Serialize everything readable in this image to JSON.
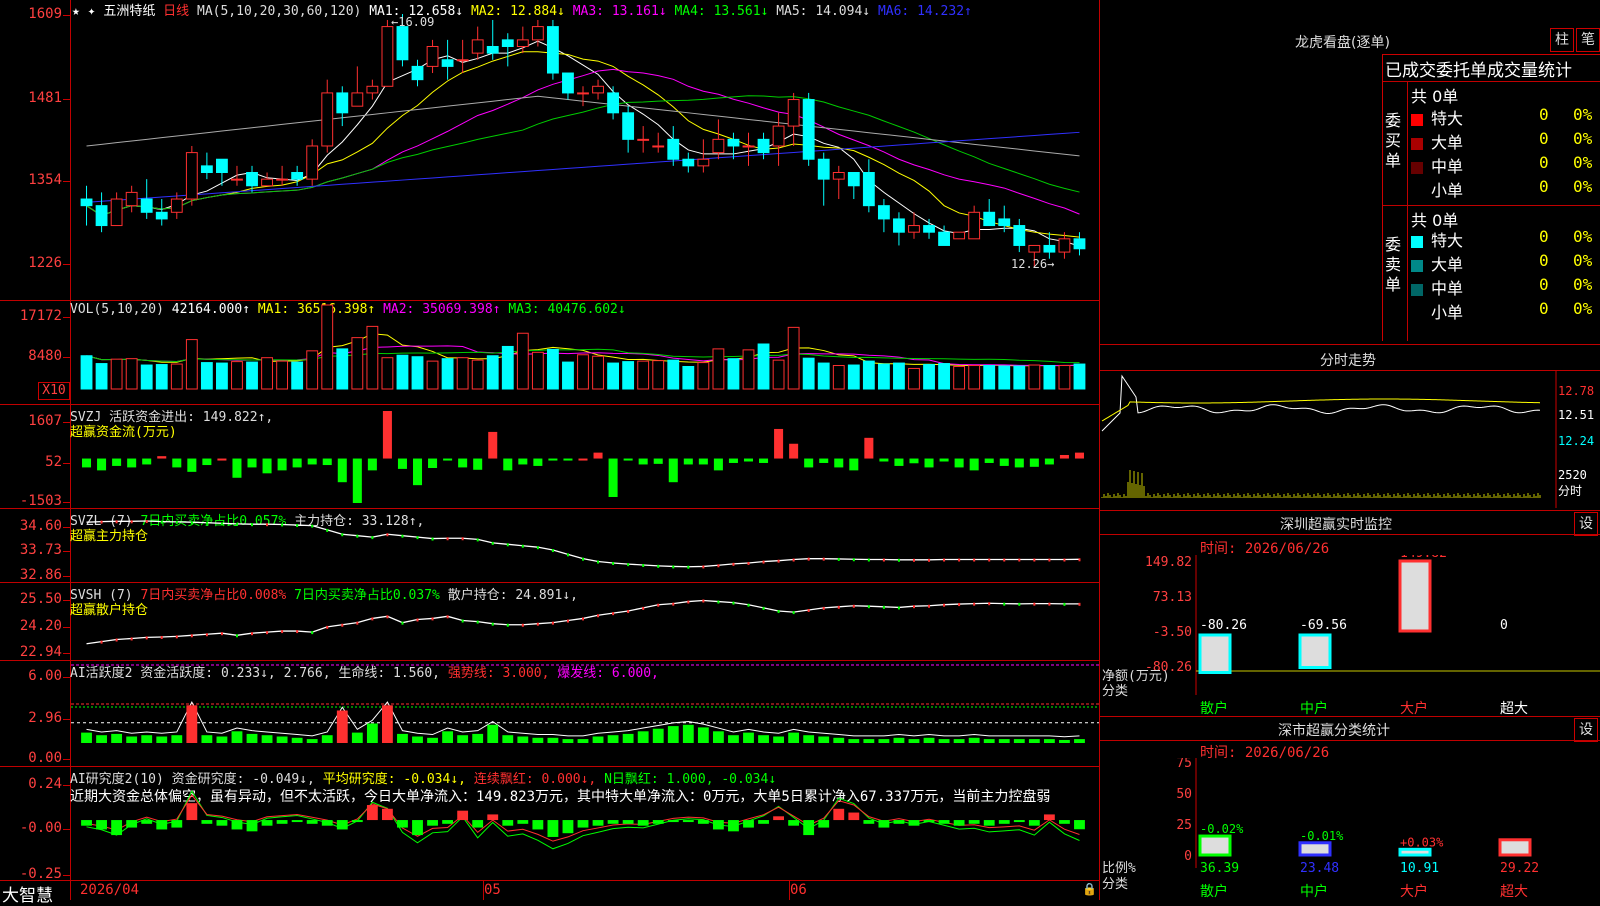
{
  "stock": {
    "name": "五洲特纸",
    "period": "日线",
    "ma_header": [
      {
        "t": "MA(5,10,20,30,60,120)",
        "c": "#ddd"
      },
      {
        "t": "MA1: 12.658↓",
        "c": "#ffffff"
      },
      {
        "t": "MA2: 12.884↓",
        "c": "#ffff00"
      },
      {
        "t": "MA3: 13.161↓",
        "c": "#ff00ff"
      },
      {
        "t": "MA4: 13.561↓",
        "c": "#00ff00"
      },
      {
        "t": "MA5: 14.094↓",
        "c": "#ddd"
      },
      {
        "t": "MA6: 14.232↑",
        "c": "#3030ff"
      }
    ],
    "y_labels": [
      "1609",
      "1481",
      "1354",
      "1226"
    ],
    "high_marker": "16.09",
    "low_marker": "12.26"
  },
  "vol": {
    "header": [
      {
        "t": "VOL(5,10,20)",
        "c": "#ddd"
      },
      {
        "t": "42164.000↑",
        "c": "#fff"
      },
      {
        "t": "MA1: 36516.398↑",
        "c": "#ffff00"
      },
      {
        "t": "MA2: 35069.398↑",
        "c": "#ff00ff"
      },
      {
        "t": "MA3: 40476.602↓",
        "c": "#00ff00"
      }
    ],
    "y_labels": [
      "17172",
      "8480"
    ],
    "unit_box": "X10"
  },
  "svzj": {
    "header": [
      {
        "t": "SVZJ  活跃资金进出: 149.822↑,",
        "c": "#ddd"
      }
    ],
    "subtitle": "超赢资金流(万元)",
    "y_labels": [
      "1607",
      "52",
      "-1503"
    ]
  },
  "svzl": {
    "header": [
      {
        "t": "SVZL (7)",
        "c": "#ddd"
      },
      {
        "t": "7日内买卖净占比0.057%",
        "c": "#00ff00"
      },
      {
        "t": "主力持仓: 33.128↑,",
        "c": "#ddd"
      }
    ],
    "subtitle": "超赢主力持仓",
    "y_labels": [
      "34.60",
      "33.73",
      "32.86"
    ]
  },
  "svsh": {
    "header": [
      {
        "t": "SVSH (7)",
        "c": "#ddd"
      },
      {
        "t": "7日内买卖净占比0.008%",
        "c": "#ff3030"
      },
      {
        "t": "7日内买卖净占比0.037%",
        "c": "#00ff00"
      },
      {
        "t": "散户持仓: 24.891↓,",
        "c": "#ddd"
      }
    ],
    "subtitle": "超赢散户持仓",
    "y_labels": [
      "25.50",
      "24.20",
      "22.94"
    ]
  },
  "ai1": {
    "header": [
      {
        "t": "AI活跃度2 资金活跃度: 0.233↓, 2.766, 生命线: 1.560,",
        "c": "#ddd"
      },
      {
        "t": "强势线: 3.000,",
        "c": "#ff3030"
      },
      {
        "t": "爆发线: 6.000,",
        "c": "#ff00ff"
      }
    ],
    "y_labels": [
      "6.00",
      "2.96",
      "0.00"
    ]
  },
  "ai2": {
    "header": [
      {
        "t": "AI研究度2(10) 资金研究度: -0.049↓,",
        "c": "#ddd"
      },
      {
        "t": "平均研究度: -0.034↓,",
        "c": "#ffff00"
      },
      {
        "t": "连续飘红: 0.000↓,",
        "c": "#ff3030"
      },
      {
        "t": "N日飘红: 1.000, -0.034↓",
        "c": "#00ff00"
      }
    ],
    "comment": "近期大资金总体偏空，虽有异动，但不太活跃，今日大单净流入：149.823万元，其中特大单净流入：0万元，大单5日累计净入67.337万元，当前主力控盘弱",
    "y_labels": [
      "0.24",
      "-0.00",
      "-0.25"
    ]
  },
  "footer": {
    "brand": "大智慧",
    "dates": [
      "2026/04",
      "05",
      "06"
    ]
  },
  "right": {
    "dragon_title": "龙虎看盘(逐单)",
    "btn_zhu": "柱",
    "btn_bi": "笔",
    "table_title": "已成交委托单成交量统计",
    "buy_side_label": "委买单",
    "sell_side_label": "委卖单",
    "buy_total": "共 0单",
    "sell_total": "共 0单",
    "buy_rows": [
      {
        "label": "特大",
        "val": "0",
        "pct": "0%",
        "color": "#ff0000"
      },
      {
        "label": "大单",
        "val": "0",
        "pct": "0%",
        "color": "#aa0000"
      },
      {
        "label": "中单",
        "val": "0",
        "pct": "0%",
        "color": "#660000"
      },
      {
        "label": "小单",
        "val": "0",
        "pct": "0%",
        "color": "#000000"
      }
    ],
    "sell_rows": [
      {
        "label": "特大",
        "val": "0",
        "pct": "0%",
        "color": "#00ffff"
      },
      {
        "label": "大单",
        "val": "0",
        "pct": "0%",
        "color": "#008888"
      },
      {
        "label": "中单",
        "val": "0",
        "pct": "0%",
        "color": "#006666"
      },
      {
        "label": "小单",
        "val": "0",
        "pct": "0%",
        "color": "#000000"
      }
    ],
    "intraday_title": "分时走势",
    "intraday_labels": [
      "12.78",
      "12.51",
      "12.24",
      "2520",
      "分时"
    ],
    "monitor_title": "深圳超赢实时监控",
    "btn_set1": "设",
    "monitor_time": "时间: 2026/06/26",
    "monitor_y": [
      "149.82",
      "73.13",
      "-3.50",
      "-80.26"
    ],
    "monitor_axis": [
      "净额(万元)",
      "分类"
    ],
    "monitor_cats": [
      "散户",
      "中户",
      "大户",
      "超大"
    ],
    "monitor_vals": [
      "-80.26",
      "-69.56",
      "149.82",
      "0"
    ],
    "class_title": "深市超赢分类统计",
    "btn_set2": "设",
    "class_time": "时间: 2026/06/26",
    "class_y": [
      "75",
      "50",
      "25",
      "0"
    ],
    "class_axis": [
      "比例%",
      "分类"
    ],
    "class_cats": [
      "散户",
      "中户",
      "大户",
      "超大"
    ],
    "class_vals": [
      "36.39",
      "23.48",
      "10.91",
      "29.22"
    ],
    "class_chg": [
      "-0.02%",
      "-0.01%",
      "+0.03%",
      ""
    ]
  },
  "chart_data": [
    {
      "type": "candlestick",
      "title": "五洲特纸 日线",
      "x_labels": [
        "2026/04",
        "05",
        "06"
      ],
      "ylim": [
        12.26,
        16.09
      ],
      "ohlc": [
        [
          13.3,
          13.2,
          13.5,
          12.9
        ],
        [
          13.2,
          12.9,
          13.4,
          12.8
        ],
        [
          12.9,
          13.3,
          13.4,
          12.9
        ],
        [
          13.2,
          13.4,
          13.5,
          13.1
        ],
        [
          13.3,
          13.1,
          13.6,
          13.0
        ],
        [
          13.1,
          13.0,
          13.3,
          12.9
        ],
        [
          13.1,
          13.3,
          13.4,
          13.0
        ],
        [
          13.3,
          14.0,
          14.1,
          13.2
        ],
        [
          13.8,
          13.7,
          14.0,
          13.6
        ],
        [
          13.9,
          13.7,
          13.9,
          13.5
        ],
        [
          13.6,
          13.6,
          13.8,
          13.5
        ],
        [
          13.7,
          13.5,
          13.8,
          13.4
        ],
        [
          13.5,
          13.6,
          13.7,
          13.5
        ],
        [
          13.6,
          13.6,
          13.8,
          13.5
        ],
        [
          13.7,
          13.6,
          13.8,
          13.5
        ],
        [
          13.6,
          14.1,
          14.2,
          13.5
        ],
        [
          14.1,
          14.9,
          15.1,
          14.0
        ],
        [
          14.9,
          14.6,
          15.0,
          14.4
        ],
        [
          14.7,
          14.9,
          15.3,
          14.7
        ],
        [
          14.9,
          15.0,
          15.1,
          14.8
        ],
        [
          15.0,
          15.9,
          16.0,
          15.0
        ],
        [
          15.9,
          15.4,
          16.09,
          15.3
        ],
        [
          15.3,
          15.1,
          15.4,
          15.0
        ],
        [
          15.3,
          15.6,
          15.7,
          15.2
        ],
        [
          15.4,
          15.3,
          15.7,
          15.1
        ],
        [
          15.4,
          15.4,
          15.7,
          15.2
        ],
        [
          15.5,
          15.7,
          15.9,
          15.4
        ],
        [
          15.6,
          15.5,
          16.0,
          15.4
        ],
        [
          15.7,
          15.6,
          15.8,
          15.3
        ],
        [
          15.6,
          15.7,
          15.9,
          15.5
        ],
        [
          15.7,
          15.9,
          16.0,
          15.6
        ],
        [
          15.9,
          15.2,
          16.0,
          15.1
        ],
        [
          15.2,
          14.9,
          15.2,
          14.8
        ],
        [
          14.9,
          14.9,
          15.0,
          14.7
        ],
        [
          14.9,
          15.0,
          15.1,
          14.8
        ],
        [
          14.9,
          14.6,
          15.0,
          14.5
        ],
        [
          14.6,
          14.2,
          14.7,
          14.0
        ],
        [
          14.2,
          14.2,
          14.4,
          14.0
        ],
        [
          14.1,
          14.1,
          14.3,
          14.0
        ],
        [
          14.2,
          13.9,
          14.4,
          13.8
        ],
        [
          13.9,
          13.8,
          14.0,
          13.7
        ],
        [
          13.8,
          13.9,
          14.2,
          13.7
        ],
        [
          14.0,
          14.2,
          14.5,
          13.9
        ],
        [
          14.2,
          14.1,
          14.3,
          13.9
        ],
        [
          14.1,
          14.1,
          14.3,
          13.8
        ],
        [
          14.2,
          14.0,
          14.3,
          13.9
        ],
        [
          14.1,
          14.4,
          14.6,
          13.8
        ],
        [
          14.4,
          14.8,
          14.9,
          14.1
        ],
        [
          14.8,
          13.9,
          14.9,
          13.8
        ],
        [
          13.9,
          13.6,
          14.0,
          13.2
        ],
        [
          13.6,
          13.7,
          13.8,
          13.3
        ],
        [
          13.7,
          13.5,
          13.7,
          13.3
        ],
        [
          13.7,
          13.2,
          13.9,
          13.1
        ],
        [
          13.2,
          13.0,
          13.3,
          12.8
        ],
        [
          13.0,
          12.8,
          13.1,
          12.6
        ],
        [
          12.8,
          12.9,
          13.1,
          12.7
        ],
        [
          12.9,
          12.8,
          13.0,
          12.7
        ],
        [
          12.8,
          12.6,
          12.9,
          12.6
        ],
        [
          12.7,
          12.8,
          12.8,
          12.7
        ],
        [
          12.7,
          13.1,
          13.2,
          12.7
        ],
        [
          13.1,
          12.9,
          13.3,
          12.9
        ],
        [
          13.0,
          12.9,
          13.2,
          12.8
        ],
        [
          12.9,
          12.6,
          13.0,
          12.5
        ],
        [
          12.5,
          12.6,
          12.6,
          12.26
        ],
        [
          12.6,
          12.5,
          12.8,
          12.4
        ],
        [
          12.5,
          12.7,
          12.8,
          12.4
        ],
        [
          12.7,
          12.55,
          12.8,
          12.45
        ]
      ]
    },
    {
      "type": "bar",
      "title": "VOL(5,10,20)",
      "ylim": [
        0,
        17172
      ],
      "values": [
        6800,
        5200,
        6100,
        6200,
        4900,
        5000,
        5100,
        10100,
        5400,
        5300,
        5600,
        5500,
        6400,
        5700,
        5500,
        7800,
        17172,
        8200,
        10500,
        12800,
        6400,
        6900,
        6600,
        5700,
        6200,
        6400,
        5900,
        6800,
        8700,
        11400,
        7500,
        8100,
        5500,
        7000,
        6700,
        5300,
        5600,
        5700,
        5800,
        5900,
        4600,
        5400,
        8200,
        6200,
        8000,
        9200,
        5900,
        12600,
        6300,
        5300,
        4800,
        4900,
        5700,
        5100,
        5300,
        4200,
        5000,
        5200,
        4600,
        4800,
        4800,
        4700,
        4700,
        4900,
        4800,
        4800,
        5100
      ],
      "colors_up": "#ff3030",
      "colors_down": "#00ffff"
    },
    {
      "type": "bar",
      "title": "SVZJ 超赢资金流(万元)",
      "ylim": [
        -1503,
        1607
      ],
      "values": [
        -300,
        -400,
        -250,
        -300,
        -200,
        80,
        -300,
        -450,
        -220,
        0,
        -650,
        -300,
        -500,
        -400,
        -300,
        -200,
        -220,
        -800,
        -1503,
        -400,
        1607,
        -350,
        -900,
        -320,
        -50,
        -300,
        -380,
        900,
        -400,
        -200,
        -250,
        -50,
        -40,
        0,
        200,
        -1300,
        -40,
        -200,
        -180,
        -800,
        -200,
        -200,
        -400,
        -150,
        -100,
        -150,
        1000,
        500,
        -300,
        -150,
        -300,
        -400,
        700,
        -100,
        -250,
        -160,
        -300,
        -100,
        -300,
        -400,
        -150,
        -250,
        -300,
        -280,
        -200,
        120,
        200
      ],
      "colors_pos": "#ff3030",
      "colors_neg": "#00ff00"
    },
    {
      "type": "line",
      "title": "SVZL 超赢主力持仓",
      "ylim": [
        32.86,
        34.6
      ],
      "values": [
        34.42,
        34.44,
        34.45,
        34.45,
        34.46,
        34.44,
        34.43,
        34.42,
        34.4,
        34.38,
        34.36,
        34.35,
        34.35,
        34.34,
        34.32,
        34.3,
        34.15,
        34.0,
        33.95,
        33.9,
        34.0,
        33.95,
        33.9,
        33.85,
        33.86,
        33.86,
        33.82,
        33.7,
        33.65,
        33.6,
        33.55,
        33.45,
        33.3,
        33.15,
        33.05,
        33.0,
        32.96,
        32.93,
        32.9,
        32.88,
        32.87,
        32.88,
        32.92,
        32.97,
        33.0,
        33.05,
        33.08,
        33.12,
        33.15,
        33.15,
        33.14,
        33.13,
        33.12,
        33.12,
        33.11,
        33.11,
        33.11,
        33.12,
        33.12,
        33.12,
        33.12,
        33.12,
        33.12,
        33.12,
        33.12,
        33.12,
        33.128
      ]
    },
    {
      "type": "line",
      "title": "SVSH 超赢散户持仓",
      "ylim": [
        22.94,
        25.5
      ],
      "values": [
        23.0,
        23.1,
        23.2,
        23.25,
        23.3,
        23.32,
        23.35,
        23.4,
        23.45,
        23.5,
        23.4,
        23.5,
        23.55,
        23.6,
        23.6,
        23.55,
        23.8,
        23.9,
        24.0,
        24.2,
        24.3,
        24.0,
        24.15,
        24.2,
        24.3,
        24.1,
        24.05,
        23.95,
        23.9,
        23.9,
        23.95,
        24.0,
        24.1,
        24.2,
        24.35,
        24.45,
        24.55,
        24.7,
        24.85,
        24.9,
        25.0,
        25.05,
        25.0,
        24.95,
        24.85,
        24.7,
        24.55,
        24.5,
        24.6,
        24.7,
        24.75,
        24.8,
        24.78,
        24.75,
        24.72,
        24.78,
        24.8,
        24.85,
        24.88,
        24.9,
        24.92,
        24.9,
        24.89,
        24.9,
        24.9,
        24.89,
        24.891
      ]
    },
    {
      "type": "bar",
      "title": "AI活跃度2 资金活跃度",
      "ylim": [
        0,
        6.0
      ],
      "values": [
        0.8,
        0.6,
        0.7,
        0.5,
        0.6,
        0.5,
        0.6,
        2.9,
        0.6,
        0.5,
        0.9,
        0.7,
        0.6,
        0.5,
        0.4,
        0.3,
        0.6,
        2.5,
        0.8,
        1.5,
        2.9,
        0.7,
        0.5,
        0.4,
        0.9,
        0.6,
        0.7,
        1.4,
        0.6,
        0.5,
        0.4,
        0.4,
        0.3,
        0.3,
        0.5,
        0.6,
        0.7,
        0.9,
        1.1,
        1.3,
        1.4,
        1.2,
        0.9,
        0.6,
        0.8,
        0.6,
        0.5,
        0.8,
        0.6,
        0.5,
        0.4,
        0.3,
        0.3,
        0.3,
        0.4,
        0.3,
        0.4,
        0.3,
        0.3,
        0.4,
        0.3,
        0.3,
        0.3,
        0.3,
        0.3,
        0.233,
        0.3
      ],
      "reference_lines": {
        "生命线": 1.56,
        "强势线": 3.0,
        "爆发线": 6.0
      }
    },
    {
      "type": "bar",
      "title": "AI研究度2(10) 资金研究度",
      "ylim": [
        -0.25,
        0.24
      ],
      "values": [
        -0.03,
        -0.05,
        -0.08,
        -0.04,
        -0.02,
        -0.05,
        -0.04,
        0.09,
        -0.02,
        -0.03,
        -0.05,
        -0.06,
        -0.03,
        -0.02,
        -0.01,
        -0.02,
        -0.03,
        -0.05,
        -0.01,
        0.08,
        0.06,
        -0.04,
        -0.08,
        -0.03,
        -0.02,
        0.05,
        -0.04,
        0.03,
        -0.03,
        -0.02,
        -0.05,
        -0.09,
        -0.07,
        -0.04,
        -0.03,
        -0.02,
        -0.02,
        -0.03,
        -0.02,
        -0.01,
        -0.01,
        -0.02,
        -0.05,
        -0.06,
        -0.04,
        -0.02,
        0.02,
        -0.03,
        -0.08,
        -0.04,
        0.06,
        0.04,
        -0.02,
        -0.04,
        -0.02,
        -0.03,
        -0.01,
        -0.02,
        -0.03,
        -0.02,
        -0.03,
        -0.02,
        -0.01,
        -0.03,
        0.03,
        -0.02,
        -0.049
      ]
    },
    {
      "type": "bar",
      "title": "深圳超赢实时监控",
      "categories": [
        "散户",
        "中户",
        "大户",
        "超大"
      ],
      "values": [
        -80.26,
        -69.56,
        149.82,
        0
      ],
      "ylabel": "净额(万元)",
      "ylim": [
        -80.26,
        149.82
      ]
    },
    {
      "type": "bar",
      "title": "深市超赢分类统计",
      "categories": [
        "散户",
        "中户",
        "大户",
        "超大"
      ],
      "values": [
        36.39,
        23.48,
        10.91,
        29.22
      ],
      "ylabel": "比例%",
      "ylim": [
        0,
        75
      ]
    }
  ]
}
